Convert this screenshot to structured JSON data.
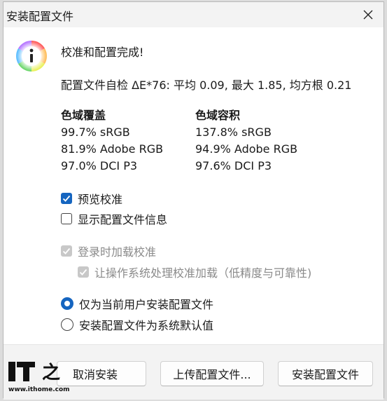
{
  "window": {
    "title": "安装配置文件"
  },
  "message": {
    "heading": "校准和配置完成!",
    "selfcheck": "配置文件自检 ΔE*76: 平均 0.09, 最大 1.85, 均方根 0.21"
  },
  "gamut_coverage": {
    "title": "色域覆盖",
    "rows": [
      "99.7% sRGB",
      "81.9% Adobe RGB",
      "97.0% DCI P3"
    ]
  },
  "gamut_volume": {
    "title": "色域容积",
    "rows": [
      "137.8% sRGB",
      "94.9% Adobe RGB",
      "97.6% DCI P3"
    ]
  },
  "options": {
    "preview": {
      "label": "预览校准",
      "checked": true
    },
    "show_info": {
      "label": "显示配置文件信息",
      "checked": false
    },
    "load_on_login": {
      "label": "登录时加载校准",
      "checked": true,
      "disabled": true
    },
    "os_handle": {
      "label": "让操作系统处理校准加载（低精度与可靠性)",
      "checked": true,
      "disabled": true
    }
  },
  "install_scope": {
    "current_user": {
      "label": "仅为当前用户安装配置文件",
      "selected": true
    },
    "system_default": {
      "label": "安装配置文件为系统默认值",
      "selected": false
    }
  },
  "buttons": {
    "cancel": "取消安装",
    "upload": "上传配置文件...",
    "install": "安装配置文件"
  },
  "watermark": {
    "url": "www.ithome.com"
  },
  "colors": {
    "accent": "#1565c0",
    "disabled": "#8a8a8a",
    "footer_bg": "#f3f3f3"
  }
}
